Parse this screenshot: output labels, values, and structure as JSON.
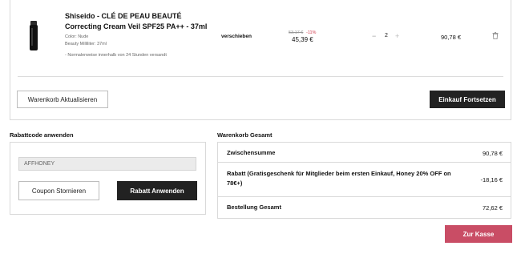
{
  "cart": {
    "item": {
      "title": "Shiseido - CLÉ DE PEAU BEAUTÉ Correcting Cream Veil SPF25 PA++ - 37ml",
      "color": "Color: Nude",
      "size": "Beauty Milliliter: 37ml",
      "shipping_note": "- Normalerweise innerhalb von 24 Stunden versandt",
      "move_label": "verschieben",
      "old_price": "53,17 €",
      "discount": "-11%",
      "price": "45,39 €",
      "quantity": "2",
      "qty_minus": "−",
      "qty_plus": "+",
      "line_total": "90,78 €"
    },
    "update_label": "Warenkorb Aktualisieren",
    "continue_label": "Einkauf Fortsetzen"
  },
  "coupon": {
    "heading": "Rabattcode anwenden",
    "code_value": "AFFHONEY",
    "cancel_label": "Coupon Stornieren",
    "apply_label": "Rabatt Anwenden"
  },
  "totals": {
    "heading": "Warenkorb Gesamt",
    "rows": [
      {
        "label": "Zwischensumme",
        "value": "90,78 €"
      },
      {
        "label": "Rabatt (Gratisgeschenk für Mitglieder beim ersten Einkauf, Honey 20% OFF on 78€+)",
        "value": "-18,16 €"
      },
      {
        "label": "Bestellung Gesamt",
        "value": "72,62 €"
      }
    ]
  },
  "checkout_label": "Zur Kasse",
  "icons": {
    "product": "product-tube-image",
    "trash": "trash-icon"
  },
  "colors": {
    "dark_button": "#222222",
    "checkout_button": "#c94d65",
    "discount_text": "#d0394b"
  }
}
